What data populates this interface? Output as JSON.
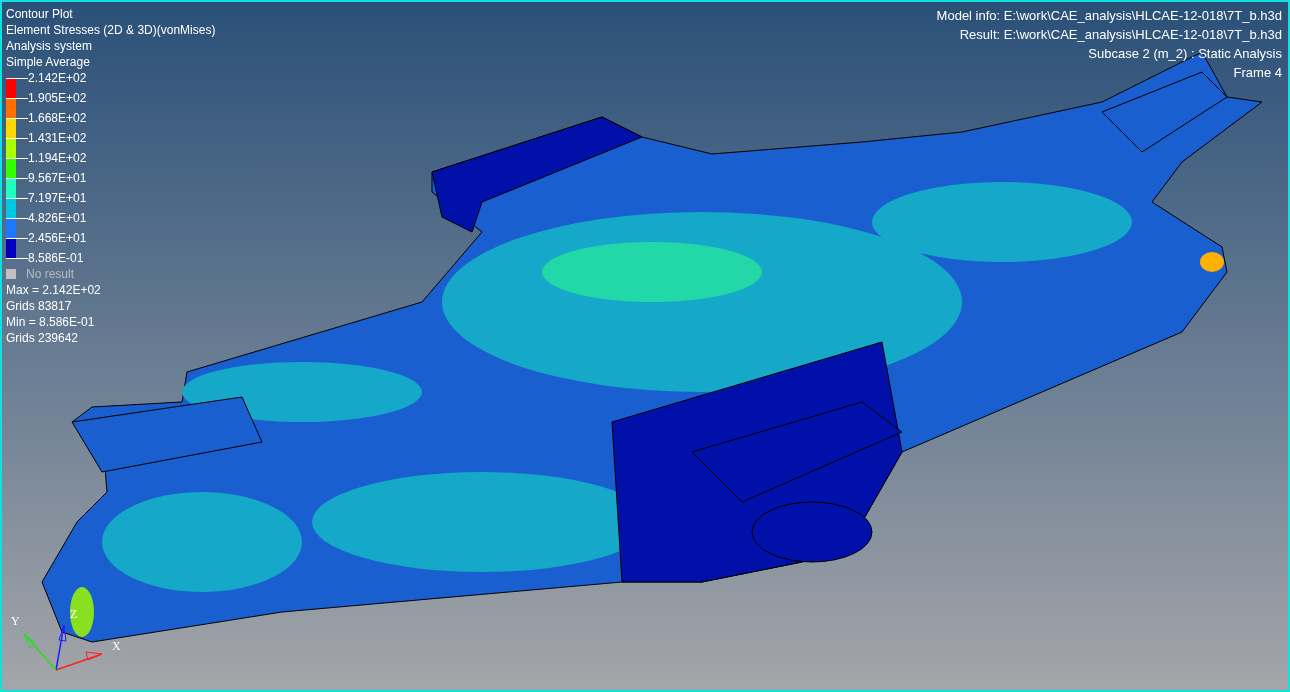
{
  "header": [
    "Contour Plot",
    "Element Stresses (2D & 3D)(vonMises)",
    "Analysis system",
    "Simple Average"
  ],
  "legend": {
    "labels": [
      "2.142E+02",
      "1.905E+02",
      "1.668E+02",
      "1.431E+02",
      "1.194E+02",
      "9.567E+01",
      "7.197E+01",
      "4.826E+01",
      "2.456E+01",
      "8.586E-01"
    ],
    "bands": [
      {
        "color": "#ff0000"
      },
      {
        "color": "#ff7000"
      },
      {
        "color": "#ffd800"
      },
      {
        "color": "#aaff00"
      },
      {
        "color": "#33ff00"
      },
      {
        "color": "#20ffc0"
      },
      {
        "color": "#00c8e0"
      },
      {
        "color": "#1e78ff"
      },
      {
        "color": "#0000c0"
      }
    ],
    "no_result": "No result"
  },
  "stats": [
    "Max = 2.142E+02",
    "Grids 83817",
    "Min = 8.586E-01",
    "Grids 239642"
  ],
  "model_info": [
    "Model info: E:\\work\\CAE_analysis\\HLCAE-12-018\\7T_b.h3d",
    "Result: E:\\work\\CAE_analysis\\HLCAE-12-018\\7T_b.h3d",
    "Subcase 2 (m_2) : Static Analysis",
    "Frame 4"
  ],
  "axes": {
    "x": "X",
    "y": "Y",
    "z": "Z"
  }
}
